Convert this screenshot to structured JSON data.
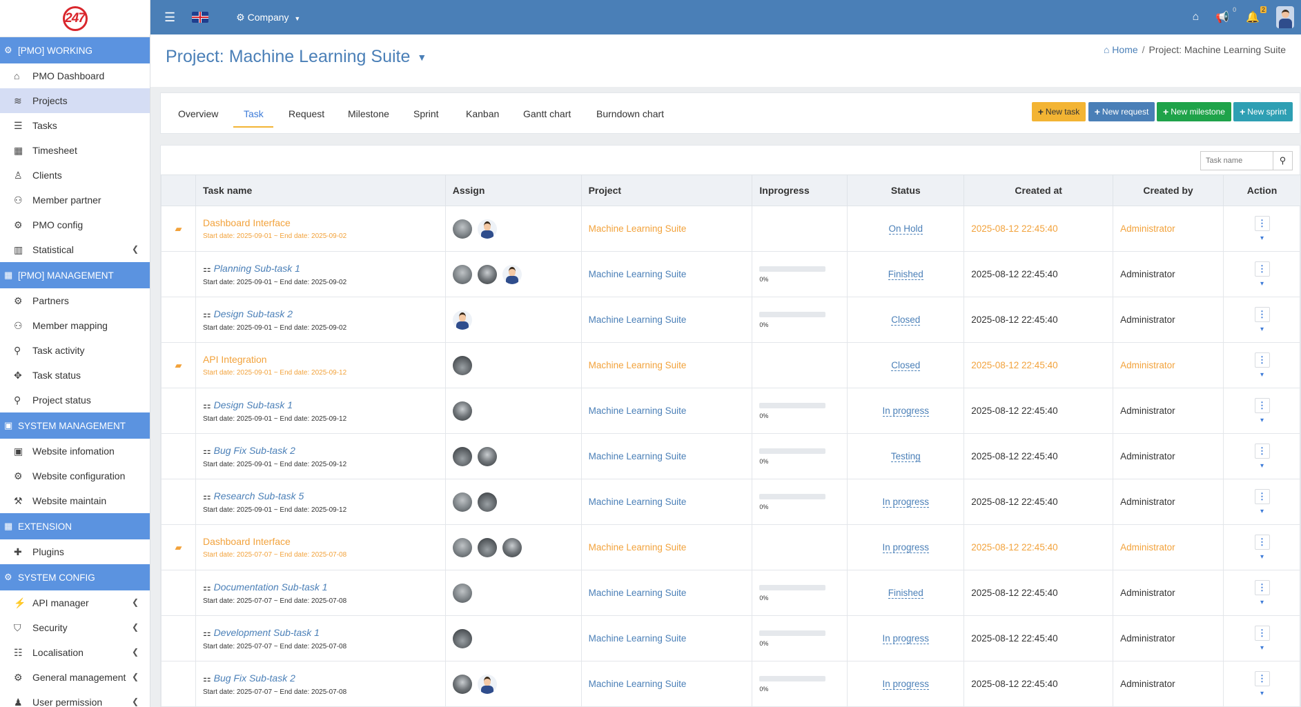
{
  "topbar": {
    "company_label": "Company",
    "messages_count": "0",
    "notifications_count": "2"
  },
  "sidebar": {
    "sections": [
      {
        "title": "[PMO] WORKING",
        "items": [
          {
            "label": "PMO Dashboard",
            "icon": "home-icon"
          },
          {
            "label": "Projects",
            "icon": "layers-icon",
            "active": true
          },
          {
            "label": "Tasks",
            "icon": "tasks-icon"
          },
          {
            "label": "Timesheet",
            "icon": "grid-icon"
          },
          {
            "label": "Clients",
            "icon": "user-tie-icon"
          },
          {
            "label": "Member partner",
            "icon": "users-icon"
          },
          {
            "label": "PMO config",
            "icon": "gear-icon"
          },
          {
            "label": "Statistical",
            "icon": "chart-icon",
            "expandable": true
          }
        ]
      },
      {
        "title": "[PMO] MANAGEMENT",
        "items": [
          {
            "label": "Partners",
            "icon": "gear-icon"
          },
          {
            "label": "Member mapping",
            "icon": "users-icon"
          },
          {
            "label": "Task activity",
            "icon": "sitemap-icon"
          },
          {
            "label": "Task status",
            "icon": "fan-icon"
          },
          {
            "label": "Project status",
            "icon": "pin-icon"
          }
        ]
      },
      {
        "title": "SYSTEM MANAGEMENT",
        "items": [
          {
            "label": "Website infomation",
            "icon": "info-icon"
          },
          {
            "label": "Website configuration",
            "icon": "gear-icon"
          },
          {
            "label": "Website maintain",
            "icon": "wrench-icon"
          }
        ]
      },
      {
        "title": "EXTENSION",
        "items": [
          {
            "label": "Plugins",
            "icon": "puzzle-icon"
          }
        ]
      },
      {
        "title": "SYSTEM CONFIG",
        "items": [
          {
            "label": "API manager",
            "icon": "plug-icon",
            "expandable": true
          },
          {
            "label": "Security",
            "icon": "shield-icon",
            "expandable": true
          },
          {
            "label": "Localisation",
            "icon": "sliders-icon",
            "expandable": true
          },
          {
            "label": "General management",
            "icon": "gear-icon",
            "expandable": true
          },
          {
            "label": "User permission",
            "icon": "user-icon",
            "expandable": true
          }
        ]
      }
    ]
  },
  "page": {
    "title": "Project: Machine Learning Suite",
    "breadcrumb_home": "Home",
    "breadcrumb_current": "Project: Machine Learning Suite"
  },
  "tabs": [
    "Overview",
    "Task",
    "Request",
    "Milestone",
    "Sprint",
    "Kanban",
    "Gantt chart",
    "Burndown chart"
  ],
  "active_tab": "Task",
  "buttons": {
    "new_task": "New task",
    "new_request": "New request",
    "new_milestone": "New milestone",
    "new_sprint": "New sprint"
  },
  "colors": {
    "topbar": "#4a7fb7",
    "section": "#5b93e0",
    "task_btn": "#f3b433",
    "request_btn": "#4a7fb7",
    "milestone_btn": "#1fa34a",
    "sprint_btn": "#2e9fb3",
    "parent_task": "#f2a23b"
  },
  "search": {
    "placeholder": "Task name"
  },
  "table": {
    "headers": [
      "Task name",
      "Assign",
      "Project",
      "Inprogress",
      "Status",
      "Created at",
      "Created by",
      "Action"
    ],
    "rows": [
      {
        "kind": "parent",
        "name": "Dashboard Interface",
        "dates": "Start date: 2025-09-01 ~ End date: 2025-09-02",
        "assign": [
          "g1",
          "person"
        ],
        "project": "Machine Learning Suite",
        "progress": "",
        "status": "On Hold",
        "created_at": "2025-08-12 22:45:40",
        "created_by": "Administrator"
      },
      {
        "kind": "sub",
        "name": "Planning Sub-task 1",
        "dates": "Start date: 2025-09-01 ~ End date: 2025-09-02",
        "assign": [
          "g1",
          "g2",
          "person"
        ],
        "project": "Machine Learning Suite",
        "progress": "0%",
        "status": "Finished",
        "created_at": "2025-08-12 22:45:40",
        "created_by": "Administrator"
      },
      {
        "kind": "sub",
        "name": "Design Sub-task 2",
        "dates": "Start date: 2025-09-01 ~ End date: 2025-09-02",
        "assign": [
          "person"
        ],
        "project": "Machine Learning Suite",
        "progress": "0%",
        "status": "Closed",
        "created_at": "2025-08-12 22:45:40",
        "created_by": "Administrator"
      },
      {
        "kind": "parent",
        "name": "API Integration",
        "dates": "Start date: 2025-09-01 ~ End date: 2025-09-12",
        "assign": [
          "g3"
        ],
        "project": "Machine Learning Suite",
        "progress": "",
        "status": "Closed",
        "created_at": "2025-08-12 22:45:40",
        "created_by": "Administrator"
      },
      {
        "kind": "sub",
        "name": "Design Sub-task 1",
        "dates": "Start date: 2025-09-01 ~ End date: 2025-09-12",
        "assign": [
          "g2"
        ],
        "project": "Machine Learning Suite",
        "progress": "0%",
        "status": "In progress",
        "created_at": "2025-08-12 22:45:40",
        "created_by": "Administrator"
      },
      {
        "kind": "sub",
        "name": "Bug Fix Sub-task 2",
        "dates": "Start date: 2025-09-01 ~ End date: 2025-09-12",
        "assign": [
          "g3",
          "g2"
        ],
        "project": "Machine Learning Suite",
        "progress": "0%",
        "status": "Testing",
        "created_at": "2025-08-12 22:45:40",
        "created_by": "Administrator"
      },
      {
        "kind": "sub",
        "name": "Research Sub-task 5",
        "dates": "Start date: 2025-09-01 ~ End date: 2025-09-12",
        "assign": [
          "g1",
          "g3"
        ],
        "project": "Machine Learning Suite",
        "progress": "0%",
        "status": "In progress",
        "created_at": "2025-08-12 22:45:40",
        "created_by": "Administrator"
      },
      {
        "kind": "parent",
        "name": "Dashboard Interface",
        "dates": "Start date: 2025-07-07 ~ End date: 2025-07-08",
        "assign": [
          "g1",
          "g3",
          "g2"
        ],
        "project": "Machine Learning Suite",
        "progress": "",
        "status": "In progress",
        "created_at": "2025-08-12 22:45:40",
        "created_by": "Administrator"
      },
      {
        "kind": "sub",
        "name": "Documentation Sub-task 1",
        "dates": "Start date: 2025-07-07 ~ End date: 2025-07-08",
        "assign": [
          "g1"
        ],
        "project": "Machine Learning Suite",
        "progress": "0%",
        "status": "Finished",
        "created_at": "2025-08-12 22:45:40",
        "created_by": "Administrator"
      },
      {
        "kind": "sub",
        "name": "Development Sub-task 1",
        "dates": "Start date: 2025-07-07 ~ End date: 2025-07-08",
        "assign": [
          "g3"
        ],
        "project": "Machine Learning Suite",
        "progress": "0%",
        "status": "In progress",
        "created_at": "2025-08-12 22:45:40",
        "created_by": "Administrator"
      },
      {
        "kind": "sub",
        "name": "Bug Fix Sub-task 2",
        "dates": "Start date: 2025-07-07 ~ End date: 2025-07-08",
        "assign": [
          "g2",
          "person"
        ],
        "project": "Machine Learning Suite",
        "progress": "0%",
        "status": "In progress",
        "created_at": "2025-08-12 22:45:40",
        "created_by": "Administrator"
      }
    ]
  }
}
